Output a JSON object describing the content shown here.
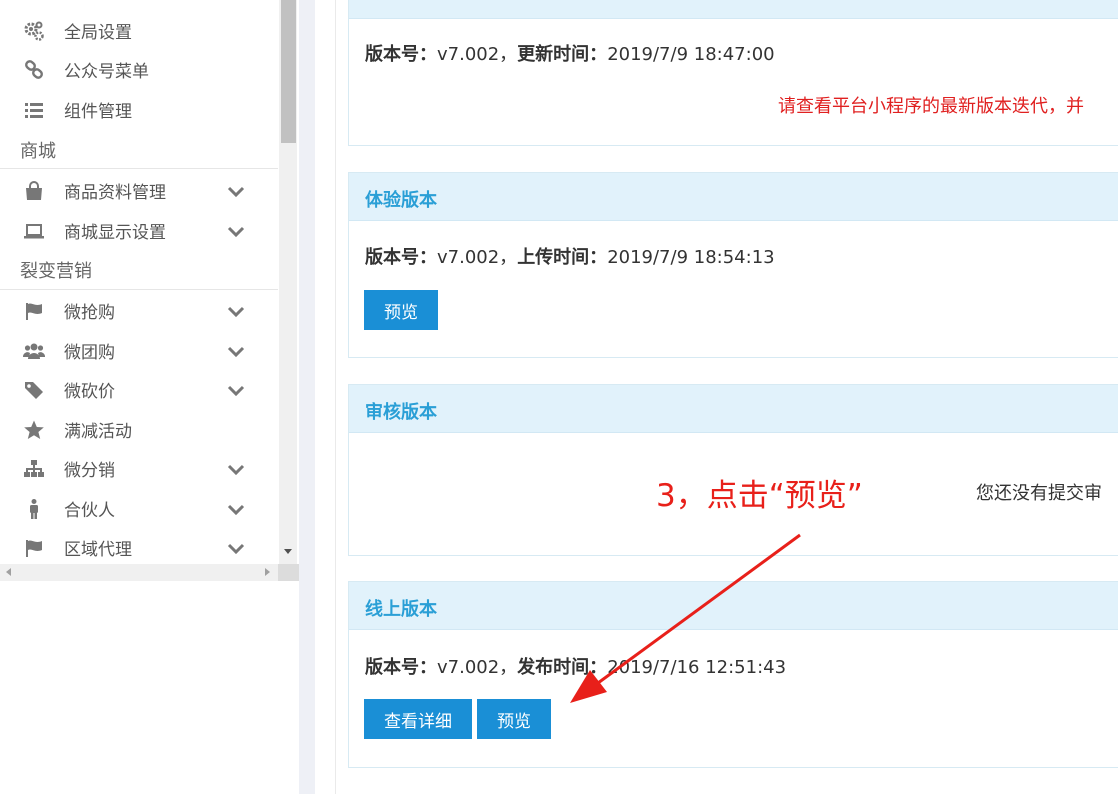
{
  "sidebar": {
    "items": [
      {
        "label": "全局设置",
        "icon": "gears-icon"
      },
      {
        "label": "公众号菜单",
        "icon": "link-icon"
      },
      {
        "label": "组件管理",
        "icon": "list-icon"
      },
      {
        "label": "商品资料管理",
        "icon": "shopping-bag-icon"
      },
      {
        "label": "商城显示设置",
        "icon": "laptop-icon"
      },
      {
        "label": "微抢购",
        "icon": "flag-icon"
      },
      {
        "label": "微团购",
        "icon": "users-icon"
      },
      {
        "label": "微砍价",
        "icon": "tag-icon"
      },
      {
        "label": "满减活动",
        "icon": "star-icon"
      },
      {
        "label": "微分销",
        "icon": "sitemap-icon"
      },
      {
        "label": "合伙人",
        "icon": "person-icon"
      },
      {
        "label": "区域代理",
        "icon": "flag-icon"
      }
    ],
    "sections": [
      "商城",
      "裂变营销"
    ]
  },
  "panels": {
    "audit_prev": {
      "version_label": "版本号：",
      "version": "v7.002，",
      "time_label": "更新时间：",
      "time": "2019/7/9 18:47:00",
      "note": "请查看平台小程序的最新版本迭代，并"
    },
    "trial": {
      "title": "体验版本",
      "version_label": "版本号：",
      "version": "v7.002，",
      "time_label": "上传时间：",
      "time": "2019/7/9 18:54:13",
      "preview_label": "预览"
    },
    "review": {
      "title": "审核版本",
      "empty_note": "您还没有提交审"
    },
    "online": {
      "title": "线上版本",
      "version_label": "版本号：",
      "version": "v7.002，",
      "time_label": "发布时间：",
      "time": "2019/7/16 12:51:43",
      "details_label": "查看详细",
      "preview_label": "预览"
    }
  },
  "annotation": {
    "text": "3，点击“预览”",
    "color": "#e8201a"
  },
  "colors": {
    "accent": "#2a9fd6",
    "button": "#1a8fd6",
    "panel_head": "#e1f2fb",
    "note_red": "#e02020"
  }
}
